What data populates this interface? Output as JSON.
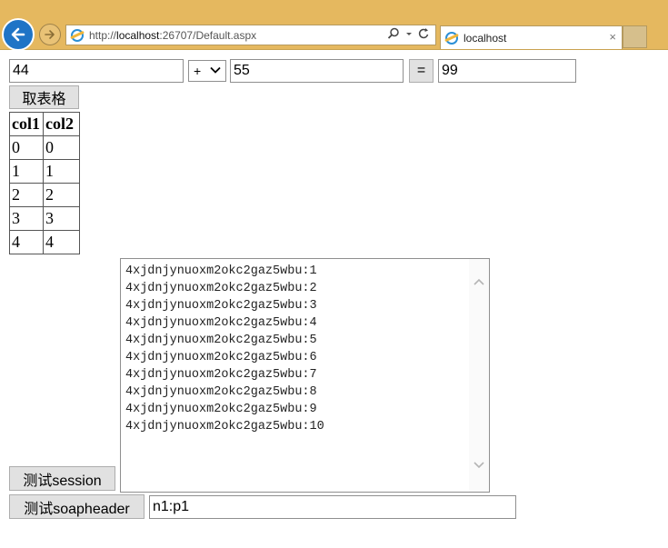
{
  "browser": {
    "url_prefix": "http://",
    "url_host": "localhost",
    "url_rest": ":26707/Default.aspx",
    "tab_title": "localhost",
    "tab_close": "×"
  },
  "calculator": {
    "operand1": "44",
    "operator": "+",
    "operand2": "55",
    "equals_label": "=",
    "result": "99"
  },
  "get_table_button": "取表格",
  "table": {
    "headers": [
      "col1",
      "col2"
    ],
    "rows": [
      [
        "0",
        "0"
      ],
      [
        "1",
        "1"
      ],
      [
        "2",
        "2"
      ],
      [
        "3",
        "3"
      ],
      [
        "4",
        "4"
      ]
    ]
  },
  "session_lines": [
    "4xjdnjynuoxm2okc2gaz5wbu:1",
    "4xjdnjynuoxm2okc2gaz5wbu:2",
    "4xjdnjynuoxm2okc2gaz5wbu:3",
    "4xjdnjynuoxm2okc2gaz5wbu:4",
    "4xjdnjynuoxm2okc2gaz5wbu:5",
    "4xjdnjynuoxm2okc2gaz5wbu:6",
    "4xjdnjynuoxm2okc2gaz5wbu:7",
    "4xjdnjynuoxm2okc2gaz5wbu:8",
    "4xjdnjynuoxm2okc2gaz5wbu:9",
    "4xjdnjynuoxm2okc2gaz5wbu:10"
  ],
  "test_session_button": "测试session",
  "test_soapheader_button": "测试soapheader",
  "soapheader_value": "n1:p1"
}
